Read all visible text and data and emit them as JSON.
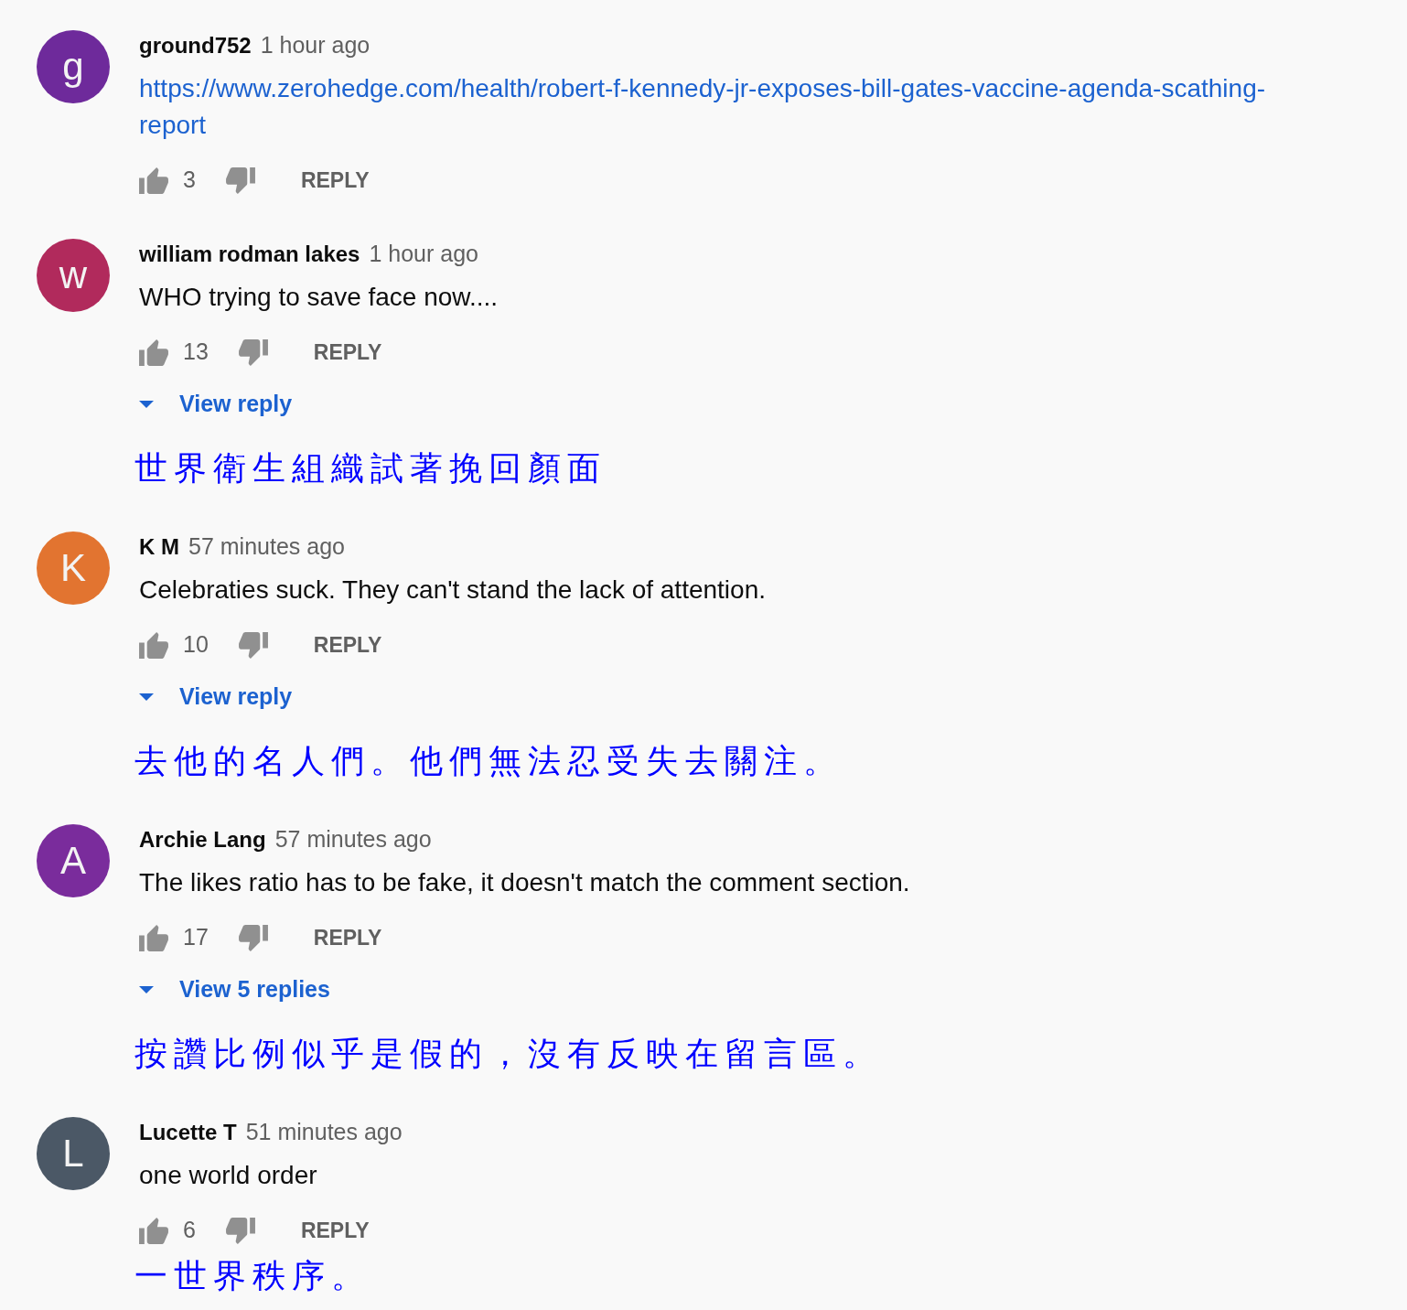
{
  "comments": [
    {
      "avatar": {
        "letter": "g",
        "color": "#6e2a9b"
      },
      "author": "ground752",
      "time": "1 hour ago",
      "kind": "link",
      "text": "https://www.zerohedge.com/health/robert-f-kennedy-jr-exposes-bill-gates-vaccine-agenda-scathing-report",
      "likes": "3",
      "reply_label": "REPLY"
    },
    {
      "avatar": {
        "letter": "w",
        "color": "#b12a5c"
      },
      "author": "william rodman lakes",
      "time": "1 hour ago",
      "kind": "text",
      "text": "WHO trying to save face now....",
      "likes": "13",
      "reply_label": "REPLY",
      "view_replies": "View reply",
      "translation": "世界衛生組織試著挽回顏面"
    },
    {
      "avatar": {
        "letter": "K",
        "color": "#e27430"
      },
      "author": "K M",
      "time": "57 minutes ago",
      "kind": "text",
      "text": "Celebraties suck. They can't stand the lack of attention.",
      "likes": "10",
      "reply_label": "REPLY",
      "view_replies": "View reply",
      "translation": "去他的名人們。他們無法忍受失去關注。"
    },
    {
      "avatar": {
        "letter": "A",
        "color": "#7a2c9c"
      },
      "author": "Archie Lang",
      "time": "57 minutes ago",
      "kind": "text",
      "text": "The likes ratio has to be fake, it doesn't match the comment section.",
      "likes": "17",
      "reply_label": "REPLY",
      "view_replies": "View 5 replies",
      "translation": "按讚比例似乎是假的，沒有反映在留言區。"
    },
    {
      "avatar": {
        "letter": "L",
        "color": "#4b5866"
      },
      "author": "Lucette T",
      "time": "51 minutes ago",
      "kind": "text",
      "text": "one world order",
      "likes": "6",
      "reply_label": "REPLY",
      "translation": "一世界秩序。"
    }
  ]
}
